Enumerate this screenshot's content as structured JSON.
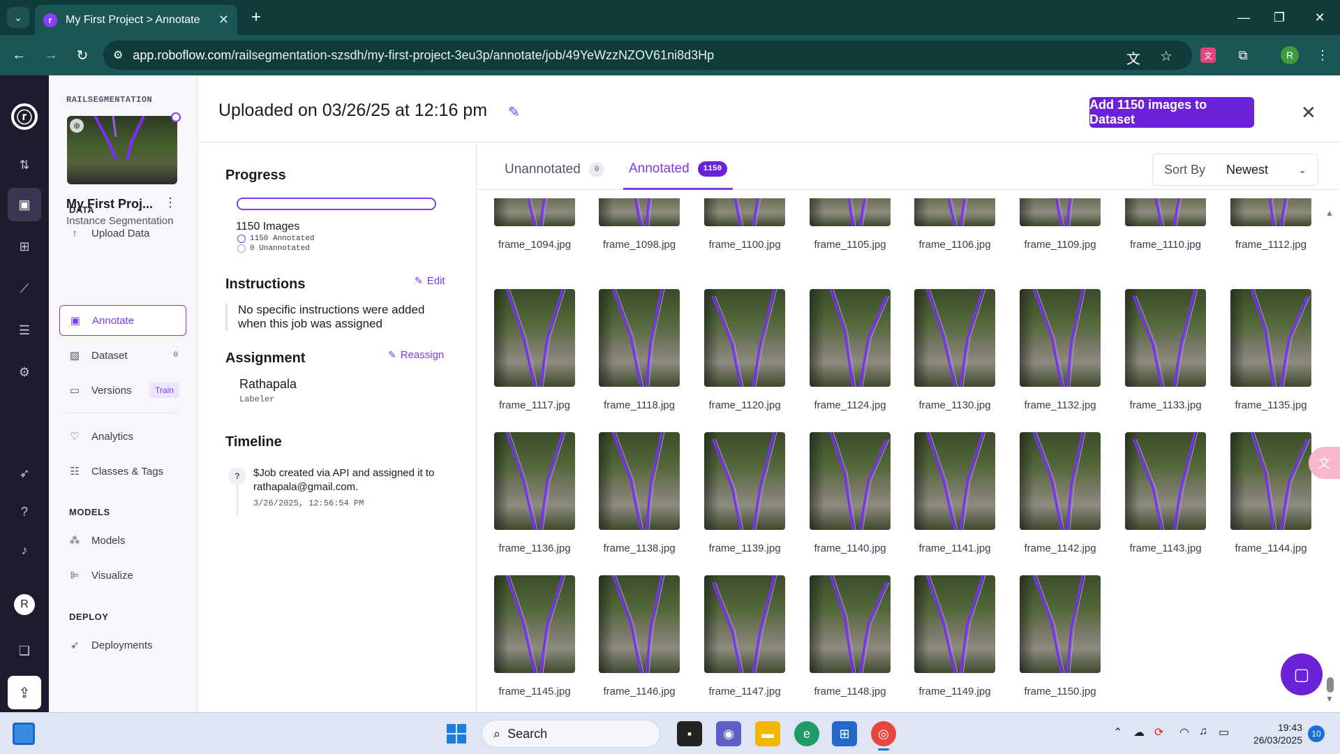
{
  "browser": {
    "tab_title": "My First Project > Annotate",
    "url_host": "app.roboflow.com",
    "url_path": "/railsegmentation-szsdh/my-first-project-3eu3p/annotate/job/49YeWzzNZOV61ni8d3Hp",
    "profile_initial": "R"
  },
  "rail": {
    "avatar_initial": "R",
    "icons": [
      "roboflow-logo-icon",
      "swap-icon",
      "inbox-icon",
      "workspace-icon",
      "chart-icon",
      "stack-icon",
      "gear-icon",
      "rocket-icon",
      "help-icon",
      "bell-icon",
      "docs-icon",
      "upload-icon"
    ]
  },
  "project": {
    "workspace": "RAILSEGMENTATION",
    "name": "My First Proj...",
    "type": "Instance Segmentation",
    "sections": {
      "data": "DATA",
      "models": "MODELS",
      "deploy": "DEPLOY"
    },
    "nav": {
      "upload": "Upload Data",
      "annotate": "Annotate",
      "dataset": "Dataset",
      "dataset_count": "0",
      "versions": "Versions",
      "versions_pill": "Train",
      "analytics": "Analytics",
      "classes": "Classes & Tags",
      "models": "Models",
      "visualize": "Visualize",
      "deployments": "Deployments"
    }
  },
  "header": {
    "title": "Uploaded on 03/26/25 at 12:16 pm",
    "add_button": "Add 1150 images to Dataset"
  },
  "job": {
    "progress_heading": "Progress",
    "progress_fraction": 1.0,
    "images_total": "1150 Images",
    "annotated_legend": "1150 Annotated",
    "unannotated_legend": "0 Unannotated",
    "instructions_heading": "Instructions",
    "edit_label": "Edit",
    "instructions_text": "No specific instructions were added when this job was assigned",
    "assignment_heading": "Assignment",
    "reassign_label": "Reassign",
    "assignee": "Rathapala",
    "assignee_role": "Labeler",
    "timeline_heading": "Timeline",
    "timeline_text": "$Job created via API and assigned it to rathapala@gmail.com.",
    "timeline_time": "3/26/2025, 12:56:54 PM"
  },
  "gallery": {
    "tabs": [
      {
        "label": "Unannotated",
        "count": "0"
      },
      {
        "label": "Annotated",
        "count": "1150"
      }
    ],
    "sort_label": "Sort By",
    "sort_value": "Newest",
    "files": [
      "frame_1094.jpg",
      "frame_1098.jpg",
      "frame_1100.jpg",
      "frame_1105.jpg",
      "frame_1106.jpg",
      "frame_1109.jpg",
      "frame_1110.jpg",
      "frame_1112.jpg",
      "frame_1117.jpg",
      "frame_1118.jpg",
      "frame_1120.jpg",
      "frame_1124.jpg",
      "frame_1130.jpg",
      "frame_1132.jpg",
      "frame_1133.jpg",
      "frame_1135.jpg",
      "frame_1136.jpg",
      "frame_1138.jpg",
      "frame_1139.jpg",
      "frame_1140.jpg",
      "frame_1141.jpg",
      "frame_1142.jpg",
      "frame_1143.jpg",
      "frame_1144.jpg",
      "frame_1145.jpg",
      "frame_1146.jpg",
      "frame_1147.jpg",
      "frame_1148.jpg",
      "frame_1149.jpg",
      "frame_1150.jpg"
    ]
  },
  "taskbar": {
    "search_placeholder": "Search",
    "time": "19:43",
    "date": "26/03/2025",
    "notifications": "10"
  },
  "colors": {
    "accent": "#7c3aed",
    "button": "#6b21d8",
    "annotation": "#7b2cff"
  }
}
